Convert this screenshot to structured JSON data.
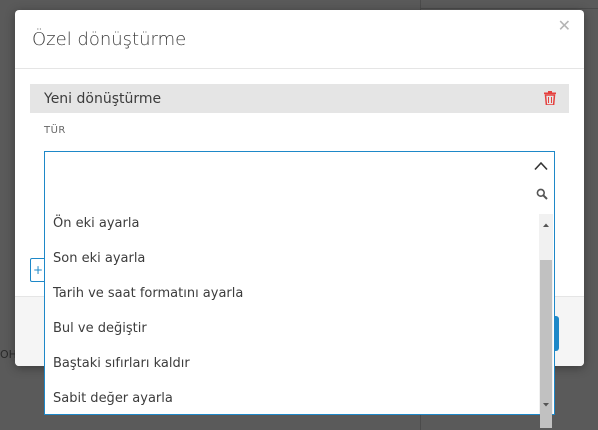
{
  "backdrop": {
    "partial_text": "OHC"
  },
  "modal": {
    "title": "Özel dönüştürme",
    "close_icon": "close-icon",
    "rule": {
      "name": "Yeni dönüştürme",
      "delete_icon": "trash-icon"
    },
    "field_label": "TÜR",
    "add_button_label": "+",
    "colors": {
      "accent": "#1e88c8",
      "delete": "#e5403e",
      "row_bg": "#e5e5e5"
    }
  },
  "dropdown": {
    "selected_value": "",
    "toggle_icon": "chevron-up-icon",
    "search_icon": "search-icon",
    "options": [
      "Ön eki ayarla",
      "Son eki ayarla",
      "Tarih ve saat formatını ayarla",
      "Bul ve değiştir",
      "Baştaki sıfırları kaldır",
      "Sabit değer ayarla"
    ]
  }
}
